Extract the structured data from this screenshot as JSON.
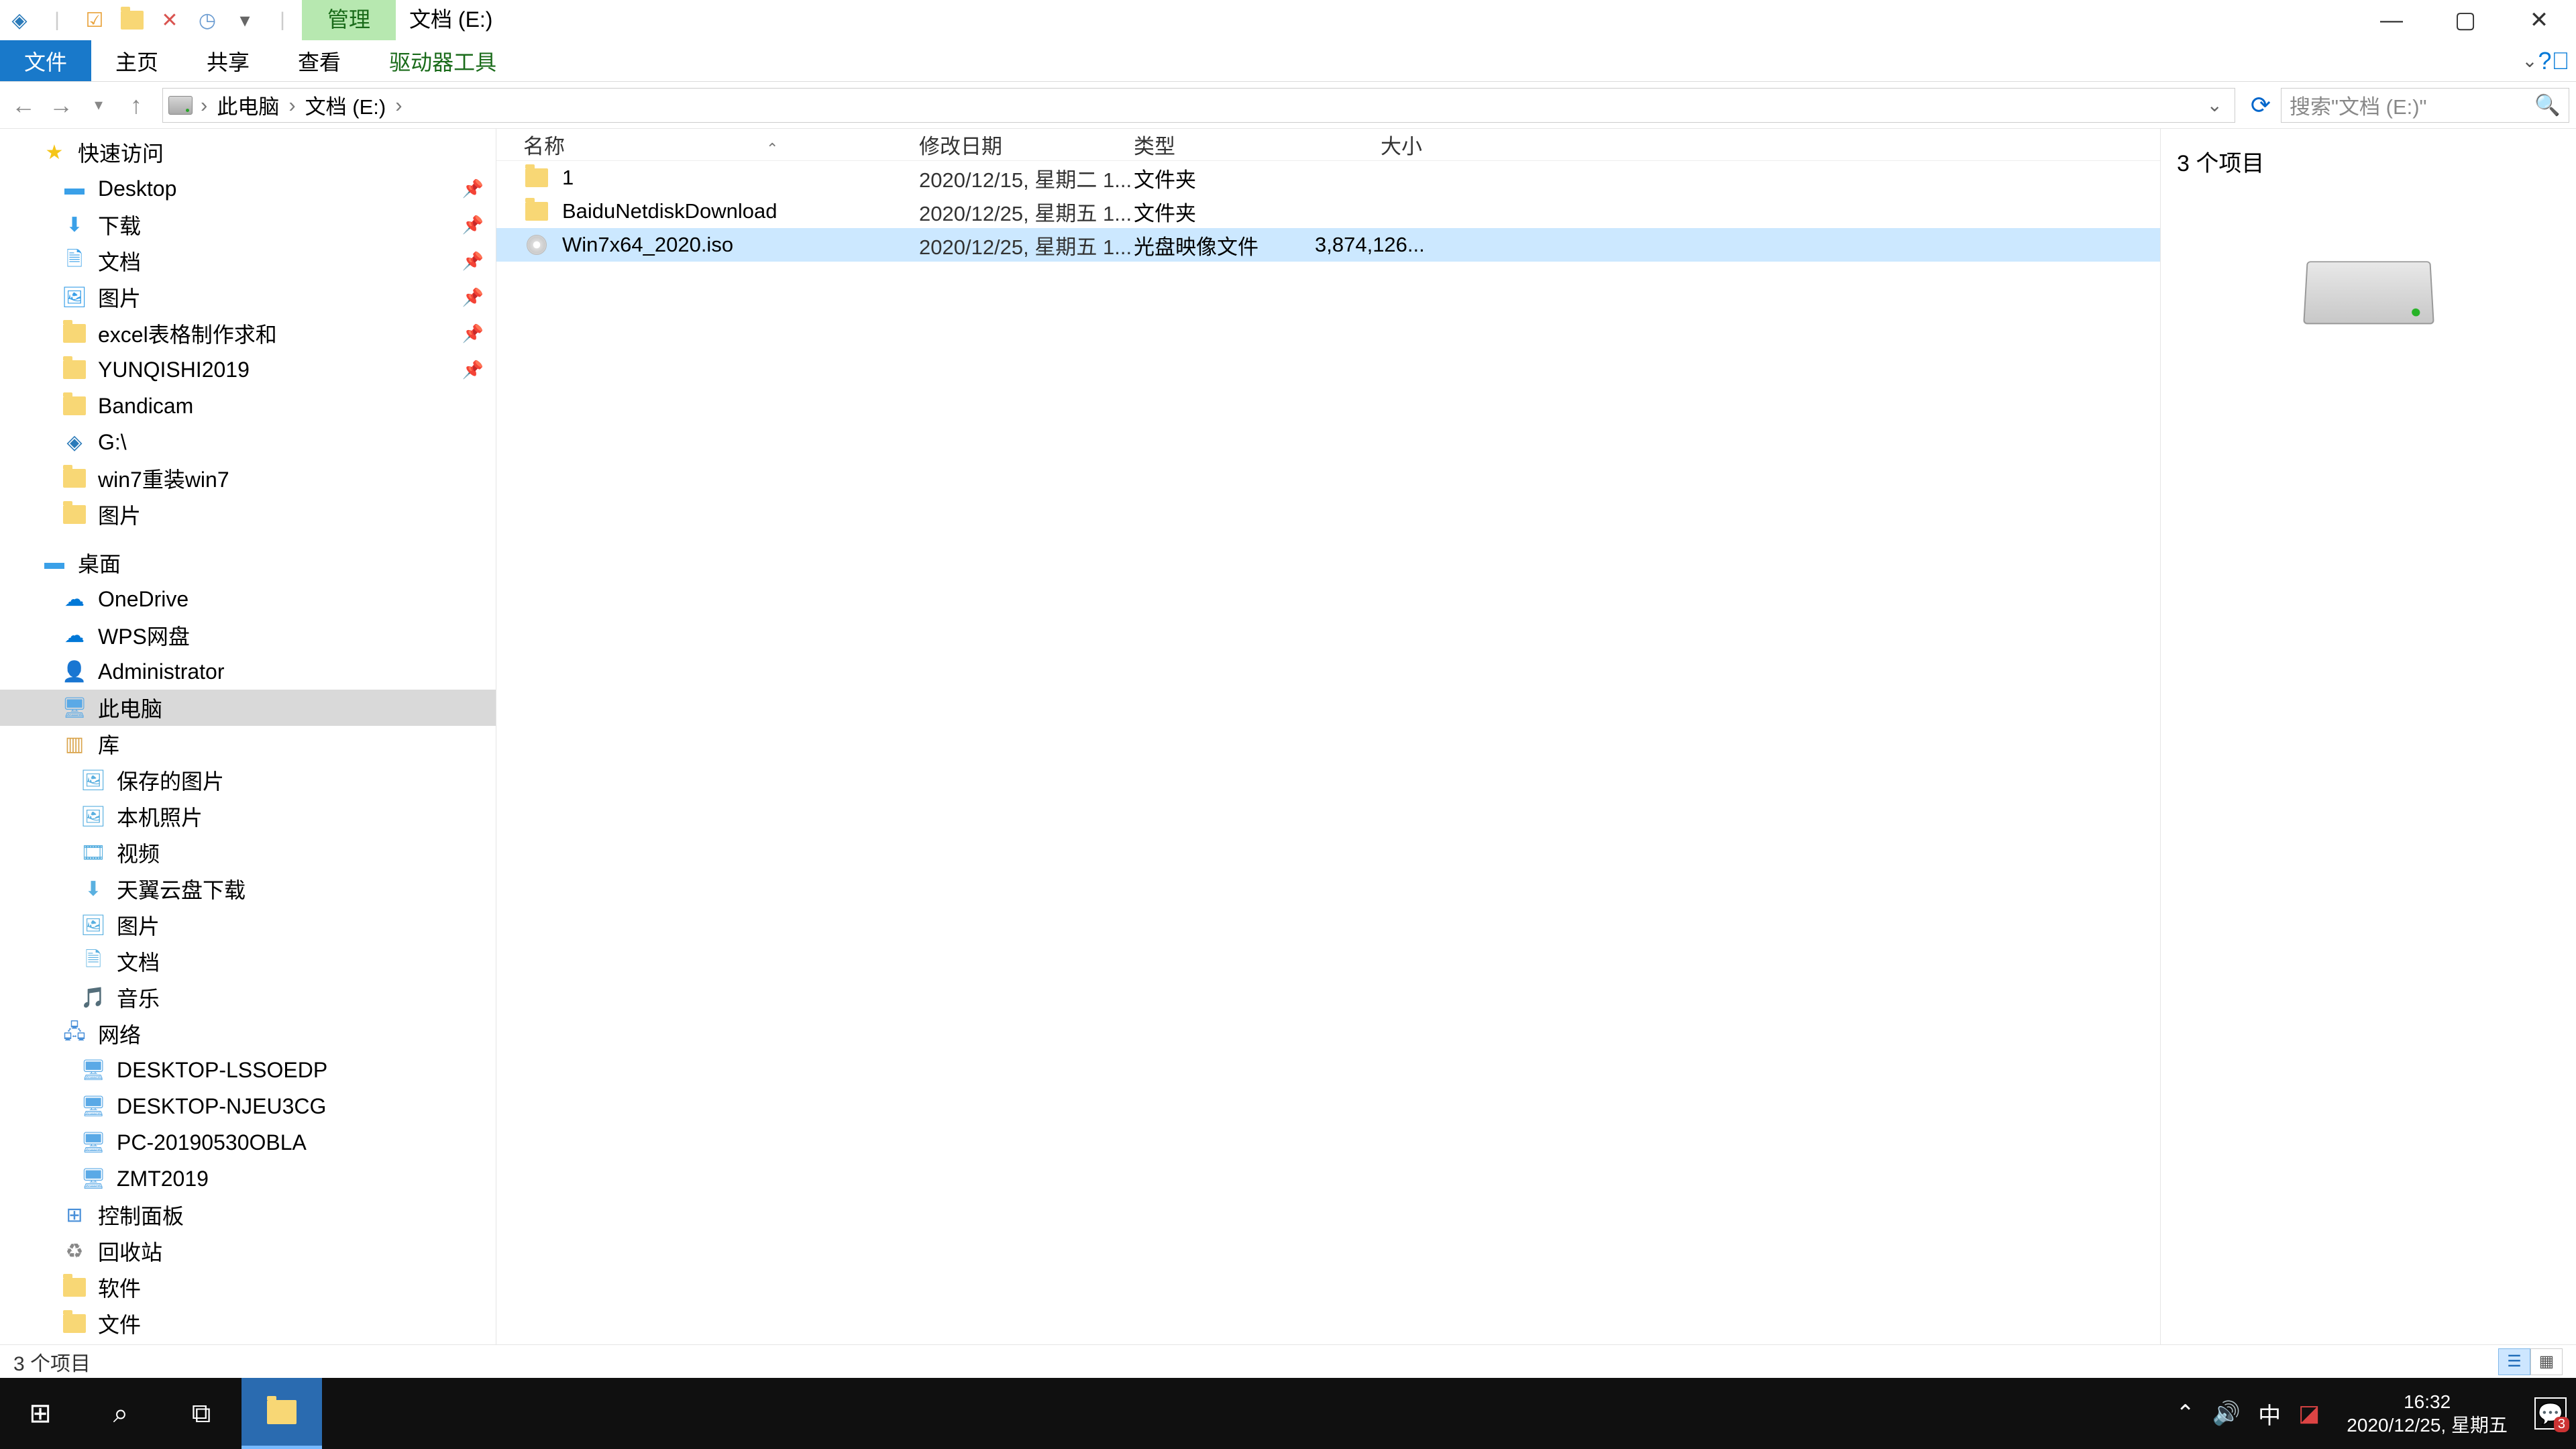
{
  "title": {
    "manage_tab": "管理",
    "location": "文档 (E:)"
  },
  "ribbon": {
    "file": "文件",
    "home": "主页",
    "share": "共享",
    "view": "查看",
    "drive_tools": "驱动器工具"
  },
  "address": {
    "crumb1": "此电脑",
    "crumb2": "文档 (E:)"
  },
  "search": {
    "placeholder": "搜索\"文档 (E:)\""
  },
  "sidebar": {
    "quick_access": "快速访问",
    "desktop": "Desktop",
    "downloads": "下载",
    "documents": "文档",
    "pictures": "图片",
    "excel": "excel表格制作求和",
    "yunqishi": "YUNQISHI2019",
    "bandicam": "Bandicam",
    "gdrive": "G:\\",
    "win7reinstall": "win7重装win7",
    "pictures2": "图片",
    "desktop_group": "桌面",
    "onedrive": "OneDrive",
    "wps": "WPS网盘",
    "admin": "Administrator",
    "thispc": "此电脑",
    "libs": "库",
    "saved_pics": "保存的图片",
    "local_photos": "本机照片",
    "videos": "视频",
    "tianyi": "天翼云盘下载",
    "pics3": "图片",
    "docs2": "文档",
    "music": "音乐",
    "network": "网络",
    "pc1": "DESKTOP-LSSOEDP",
    "pc2": "DESKTOP-NJEU3CG",
    "pc3": "PC-20190530OBLA",
    "pc4": "ZMT2019",
    "control_panel": "控制面板",
    "recycle": "回收站",
    "software": "软件",
    "files": "文件"
  },
  "columns": {
    "name": "名称",
    "modified": "修改日期",
    "type": "类型",
    "size": "大小"
  },
  "files": [
    {
      "name": "1",
      "date": "2020/12/15, 星期二 1...",
      "type": "文件夹",
      "size": "",
      "icon": "folder"
    },
    {
      "name": "BaiduNetdiskDownload",
      "date": "2020/12/25, 星期五 1...",
      "type": "文件夹",
      "size": "",
      "icon": "folder"
    },
    {
      "name": "Win7x64_2020.iso",
      "date": "2020/12/25, 星期五 1...",
      "type": "光盘映像文件",
      "size": "3,874,126...",
      "icon": "disc",
      "selected": true
    }
  ],
  "preview": {
    "count": "3 个项目"
  },
  "status": {
    "text": "3 个项目"
  },
  "taskbar": {
    "time": "16:32",
    "date": "2020/12/25, 星期五",
    "ime": "中",
    "notif_count": "3"
  }
}
